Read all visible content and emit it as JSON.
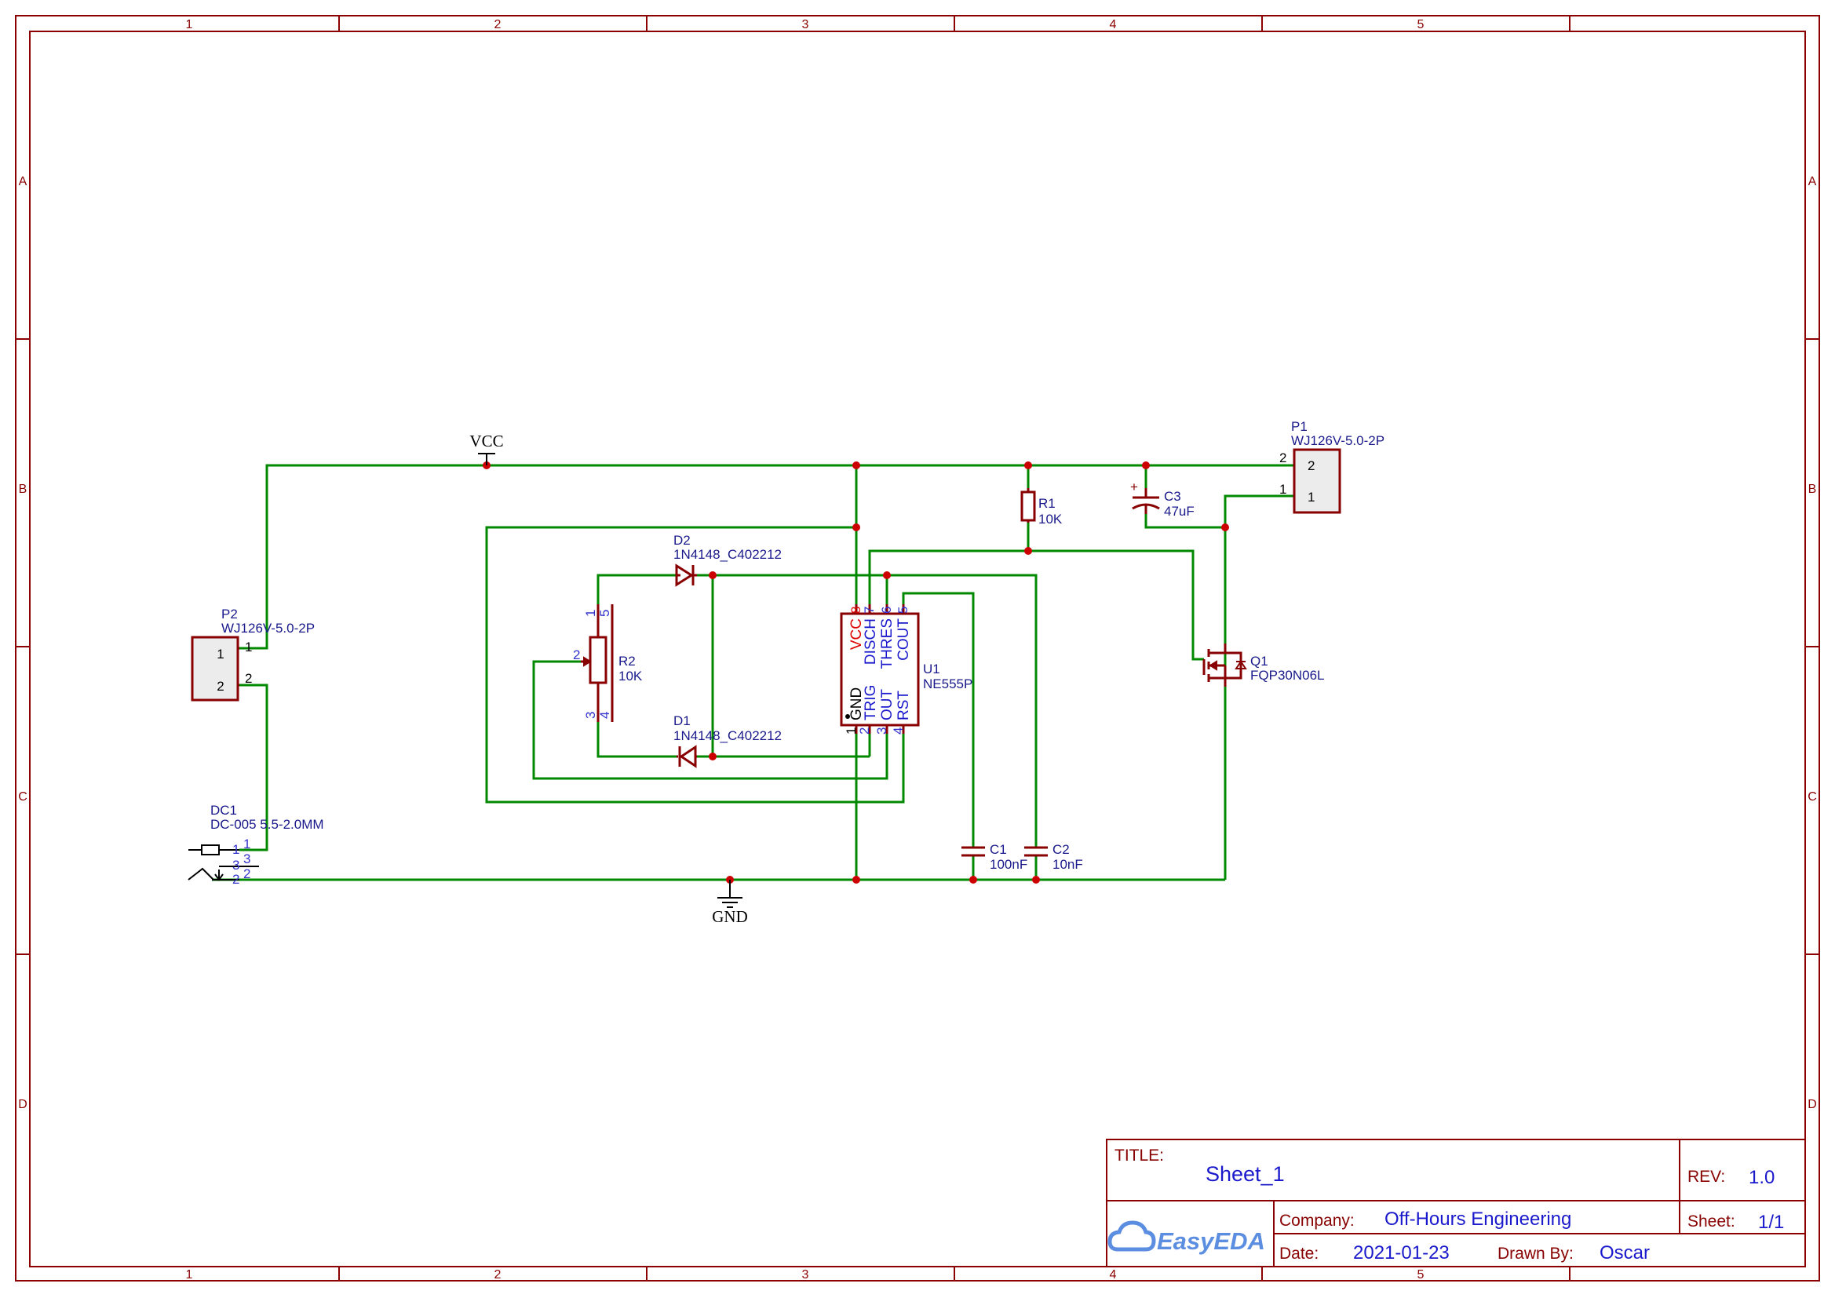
{
  "zones": {
    "columns": [
      "1",
      "2",
      "3",
      "4",
      "5"
    ],
    "rows": [
      "A",
      "B",
      "C",
      "D"
    ]
  },
  "nets": {
    "vcc": "VCC",
    "gnd": "GND"
  },
  "components": {
    "P1": {
      "ref": "P1",
      "value": "WJ126V-5.0-2P",
      "pins": [
        "2",
        "1"
      ]
    },
    "P2": {
      "ref": "P2",
      "value": "WJ126V-5.0-2P",
      "pins": [
        "1",
        "2"
      ]
    },
    "DC1": {
      "ref": "DC1",
      "value": "DC-005 5.5-2.0MM",
      "pins": [
        "1",
        "3",
        "2"
      ]
    },
    "R1": {
      "ref": "R1",
      "value": "10K"
    },
    "R2": {
      "ref": "R2",
      "value": "10K",
      "pins": [
        "1",
        "5",
        "2",
        "3",
        "4"
      ]
    },
    "C1": {
      "ref": "C1",
      "value": "100nF"
    },
    "C2": {
      "ref": "C2",
      "value": "10nF"
    },
    "C3": {
      "ref": "C3",
      "value": "47uF",
      "polarity": "+"
    },
    "D1": {
      "ref": "D1",
      "value": "1N4148_C402212"
    },
    "D2": {
      "ref": "D2",
      "value": "1N4148_C402212"
    },
    "Q1": {
      "ref": "Q1",
      "value": "FQP30N06L"
    },
    "U1": {
      "ref": "U1",
      "value": "NE555P",
      "top_pins": [
        {
          "num": "8",
          "name": "VCC"
        },
        {
          "num": "7",
          "name": "DISCH"
        },
        {
          "num": "6",
          "name": "THRES"
        },
        {
          "num": "5",
          "name": "COUT"
        }
      ],
      "bottom_pins": [
        {
          "num": "1",
          "name": "GND"
        },
        {
          "num": "2",
          "name": "TRIG"
        },
        {
          "num": "3",
          "name": "OUT"
        },
        {
          "num": "4",
          "name": "RST"
        }
      ]
    }
  },
  "title_block": {
    "title_label": "TITLE:",
    "title": "Sheet_1",
    "rev_label": "REV:",
    "rev": "1.0",
    "company_label": "Company:",
    "company": "Off-Hours Engineering",
    "sheet_label": "Sheet:",
    "sheet": "1/1",
    "date_label": "Date:",
    "date": "2021-01-23",
    "drawn_by_label": "Drawn By:",
    "drawn_by": "Oscar",
    "logo_text": "EasyEDA"
  }
}
